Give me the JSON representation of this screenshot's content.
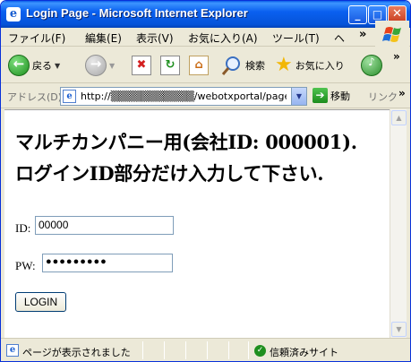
{
  "window": {
    "title": "Login Page - Microsoft Internet Explorer",
    "min_glyph": "_",
    "max_glyph": "□",
    "close_glyph": "✕"
  },
  "menu": {
    "items": [
      "ファイル(F)",
      "編集(E)",
      "表示(V)",
      "お気に入り(A)",
      "ツール(T)",
      "ヘ"
    ],
    "overflow": "»"
  },
  "toolbar": {
    "back_label": "戻る",
    "search_label": "検索",
    "favorites_label": "お気に入り",
    "overflow": "»"
  },
  "address": {
    "label": "アドレス(D)",
    "url": "http://▒▒▒▒▒▒▒▒▒▒▒/webotxportal/pages/M",
    "go_label": "移動",
    "links_label": "リンク",
    "overflow": "»"
  },
  "page": {
    "heading_line1": "マルチカンパニー用(会社ID: 000001).",
    "heading_line2": "ログインID部分だけ入力して下さい.",
    "id_label": "ID:",
    "id_value": "00000",
    "pw_label": "PW:",
    "pw_value": "●●●●●●●●●",
    "login_button": "LOGIN"
  },
  "status": {
    "text": "ページが表示されました",
    "zone": "信頼済みサイト"
  },
  "colors": {
    "titlebar": "#0a5ce8",
    "chrome": "#ece9d8",
    "content_bg": "#ffffff"
  }
}
